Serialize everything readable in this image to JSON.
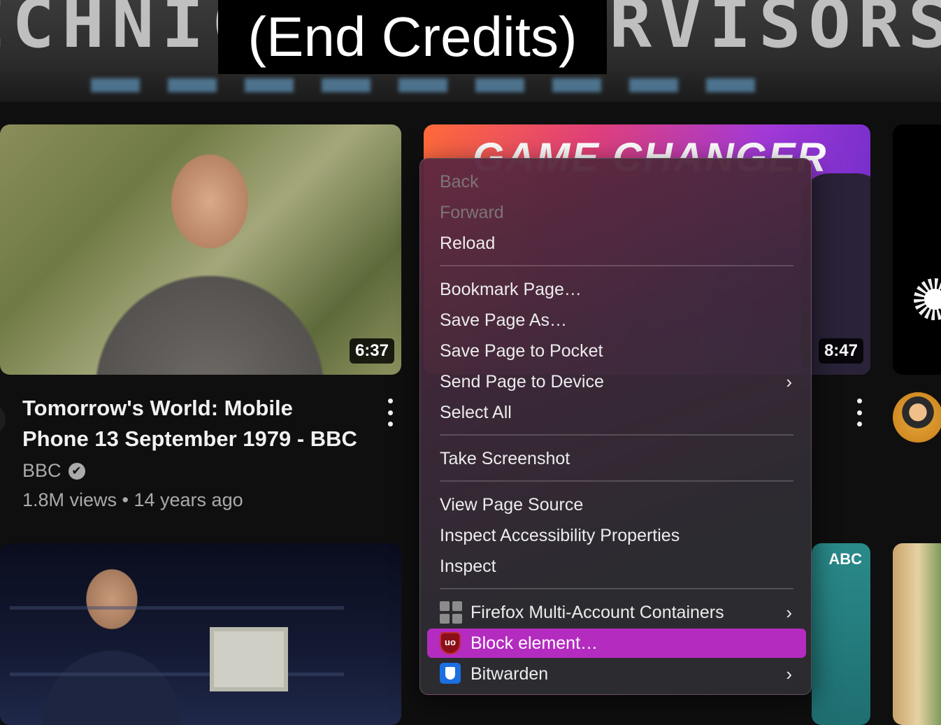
{
  "top_video": {
    "background_text": "ECHNICAL SUPERVISORS",
    "caption": "(End Credits)"
  },
  "videos": [
    {
      "title": "Tomorrow's World: Mobile Phone 13 September 1979 - BBC",
      "channel": "BBC",
      "verified_icon": "✔",
      "meta": "1.8M views • 14 years ago",
      "duration": "6:37"
    },
    {
      "thumb_text": "GAME CHANGER",
      "duration": "8:47"
    }
  ],
  "misc": {
    "abc_logo": "ABC"
  },
  "context_menu": {
    "items": [
      {
        "label": "Back",
        "enabled": false
      },
      {
        "label": "Forward",
        "enabled": false
      },
      {
        "label": "Reload",
        "enabled": true
      },
      {
        "label": "Bookmark Page…",
        "enabled": true
      },
      {
        "label": "Save Page As…",
        "enabled": true
      },
      {
        "label": "Save Page to Pocket",
        "enabled": true
      },
      {
        "label": "Send Page to Device",
        "enabled": true,
        "submenu": true
      },
      {
        "label": "Select All",
        "enabled": true
      },
      {
        "label": "Take Screenshot",
        "enabled": true
      },
      {
        "label": "View Page Source",
        "enabled": true
      },
      {
        "label": "Inspect Accessibility Properties",
        "enabled": true
      },
      {
        "label": "Inspect",
        "enabled": true
      },
      {
        "label": "Firefox Multi-Account Containers",
        "enabled": true,
        "submenu": true,
        "icon": "containers-icon"
      },
      {
        "label": "Block element…",
        "enabled": true,
        "highlighted": true,
        "icon": "ublock-icon"
      },
      {
        "label": "Bitwarden",
        "enabled": true,
        "submenu": true,
        "icon": "bitwarden-icon"
      }
    ],
    "submenu_glyph": "›",
    "ublock_glyph": "uo",
    "highlight_color": "#b42bc0"
  }
}
